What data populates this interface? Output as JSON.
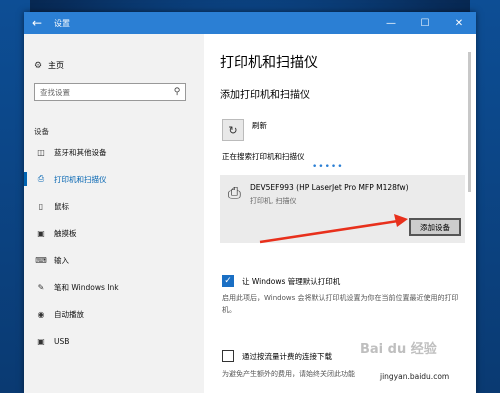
{
  "window": {
    "title": "设置",
    "back_icon": "back-arrow-icon",
    "controls": [
      "—",
      "☐",
      "✕"
    ]
  },
  "sidebar": {
    "home_label": "主页",
    "search_placeholder": "查找设置",
    "section_label": "设备",
    "items": [
      {
        "label": "蓝牙和其他设备",
        "icon": "bluetooth-icon"
      },
      {
        "label": "打印机和扫描仪",
        "icon": "printer-icon",
        "active": true
      },
      {
        "label": "鼠标",
        "icon": "mouse-icon"
      },
      {
        "label": "触摸板",
        "icon": "touchpad-icon"
      },
      {
        "label": "输入",
        "icon": "keyboard-icon"
      },
      {
        "label": "笔和 Windows Ink",
        "icon": "pen-icon"
      },
      {
        "label": "自动播放",
        "icon": "autoplay-icon"
      },
      {
        "label": "USB",
        "icon": "usb-icon"
      }
    ]
  },
  "main": {
    "title": "打印机和扫描仪",
    "subtitle": "添加打印机和扫描仪",
    "refresh_label": "刷新",
    "searching_text": "正在搜索打印机和扫描仪",
    "device": {
      "name": "DEV5EF993 (HP LaserJet Pro MFP M128fw)",
      "type": "打印机, 扫描仪",
      "add_button": "添加设备"
    },
    "option1": {
      "label": "让 Windows 管理默认打印机",
      "checked": true,
      "description": "启用此项后，Windows 会将默认打印机设置为你在当前位置最近使用的打印机。"
    },
    "option2": {
      "label": "通过按流量计费的连接下载",
      "checked": false,
      "description": "为避免产生额外的费用，请始终关闭此功能"
    }
  },
  "watermark": {
    "main": "Bai du 经验",
    "url": "jingyan.baidu.com"
  },
  "colors": {
    "accent": "#0063b1",
    "titlebar": "#2b7fd4",
    "annotation_arrow": "#e8301c"
  }
}
